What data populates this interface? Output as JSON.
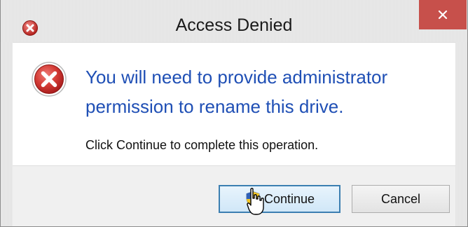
{
  "window": {
    "title": "Access Denied",
    "close_glyph": "✕",
    "title_icon": "error-small-icon",
    "accent_close_color": "#c7504b"
  },
  "content": {
    "icon": "error-icon",
    "main_instruction": "You will need to provide administrator permission to rename this drive.",
    "detail": "Click Continue to complete this operation."
  },
  "buttons": {
    "continue_label": "Continue",
    "continue_icon": "uac-shield-icon",
    "cancel_label": "Cancel"
  },
  "colors": {
    "instruction_text": "#1f4fb5",
    "primary_button_border": "#3c7fb1"
  }
}
